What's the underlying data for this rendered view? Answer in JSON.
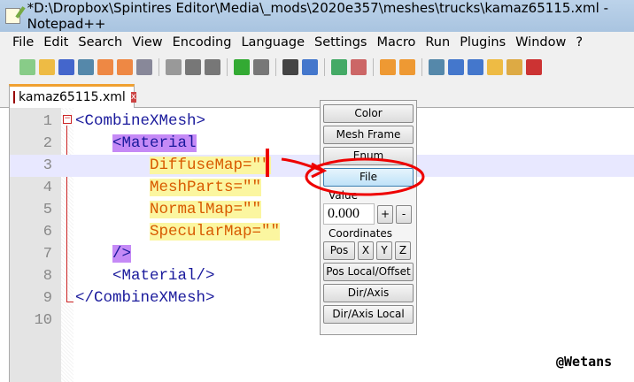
{
  "window": {
    "title": "*D:\\Dropbox\\Spintires Editor\\Media\\_mods\\2020e357\\meshes\\trucks\\kamaz65115.xml - Notepad++"
  },
  "menu": [
    "File",
    "Edit",
    "Search",
    "View",
    "Encoding",
    "Language",
    "Settings",
    "Macro",
    "Run",
    "Plugins",
    "Window",
    "?"
  ],
  "tab": {
    "label": "kamaz65115.xml",
    "close": "x"
  },
  "editor": {
    "lines": [
      {
        "n": "1",
        "indent": "",
        "parts": [
          {
            "t": "<CombineXMesh>",
            "c": "tag"
          }
        ]
      },
      {
        "n": "2",
        "indent": "    ",
        "parts": [
          {
            "t": "<Material",
            "c": "mat"
          }
        ]
      },
      {
        "n": "3",
        "indent": "        ",
        "parts": [
          {
            "t": "DiffuseMap=\"\"",
            "c": "attr"
          }
        ]
      },
      {
        "n": "4",
        "indent": "        ",
        "parts": [
          {
            "t": "MeshParts=\"\"",
            "c": "attr"
          }
        ]
      },
      {
        "n": "5",
        "indent": "        ",
        "parts": [
          {
            "t": "NormalMap=\"\"",
            "c": "attr"
          }
        ]
      },
      {
        "n": "6",
        "indent": "        ",
        "parts": [
          {
            "t": "SpecularMap=\"\"",
            "c": "attr"
          }
        ]
      },
      {
        "n": "7",
        "indent": "    ",
        "parts": [
          {
            "t": "/>",
            "c": "mat"
          }
        ]
      },
      {
        "n": "8",
        "indent": "    ",
        "parts": [
          {
            "t": "<Material/>",
            "c": "tag"
          }
        ]
      },
      {
        "n": "9",
        "indent": "",
        "parts": [
          {
            "t": "</CombineXMesh>",
            "c": "tag"
          }
        ]
      },
      {
        "n": "10",
        "indent": "",
        "parts": []
      }
    ],
    "current_line": 3
  },
  "panel": {
    "color": "Color",
    "mesh_frame": "Mesh Frame",
    "enum": "Enum",
    "file": "File",
    "value_label": "Value",
    "value": "0.000",
    "plus": "+",
    "minus": "-",
    "coords_label": "Coordinates",
    "pos": "Pos",
    "x": "X",
    "y": "Y",
    "z": "Z",
    "pos_local": "Pos Local/Offset",
    "dir_axis": "Dir/Axis",
    "dir_axis_local": "Dir/Axis Local"
  },
  "watermark": "@Wetans"
}
